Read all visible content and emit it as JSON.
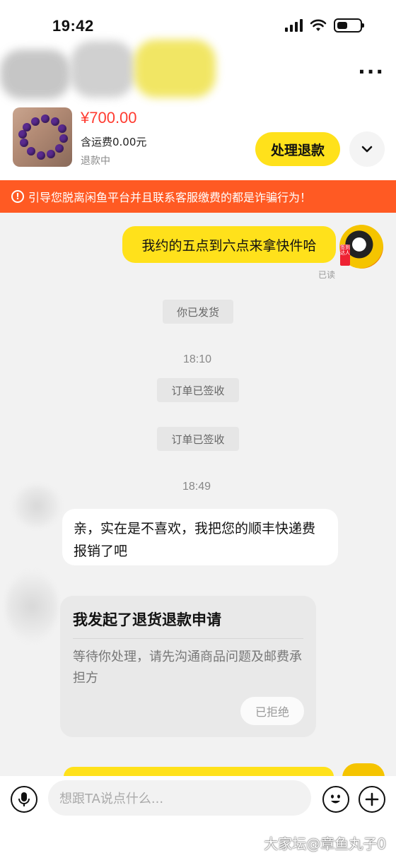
{
  "status_bar": {
    "time": "19:42"
  },
  "product": {
    "price": "¥700.00",
    "shipping": "含运费0.00元",
    "status": "退款中",
    "action_label": "处理退款"
  },
  "warning": {
    "text": "引导您脱离闲鱼平台并且联系客服缴费的都是诈骗行为！"
  },
  "messages": {
    "mine_1": "我约的五点到六点来拿快件哈",
    "mine_1_status": "已读",
    "system_1": "你已发货",
    "time_1": "18:10",
    "system_2": "订单已签收",
    "system_3": "订单已签收",
    "time_2": "18:49",
    "other_1": "亲，实在是不喜欢，我把您的顺丰快递费报销了吧"
  },
  "refund_card": {
    "title": "我发起了退货退款申请",
    "description": "等待你处理，请先沟通商品问题及邮费承担方",
    "button": "已拒绝"
  },
  "avatar_badge": "签到达人",
  "input": {
    "placeholder": "想跟TA说点什么..."
  },
  "watermark": "大家坛@章鱼丸子0",
  "colors": {
    "accent_yellow": "#ffe11b",
    "warning_orange": "#ff5a23",
    "price_red": "#ff3b30"
  }
}
